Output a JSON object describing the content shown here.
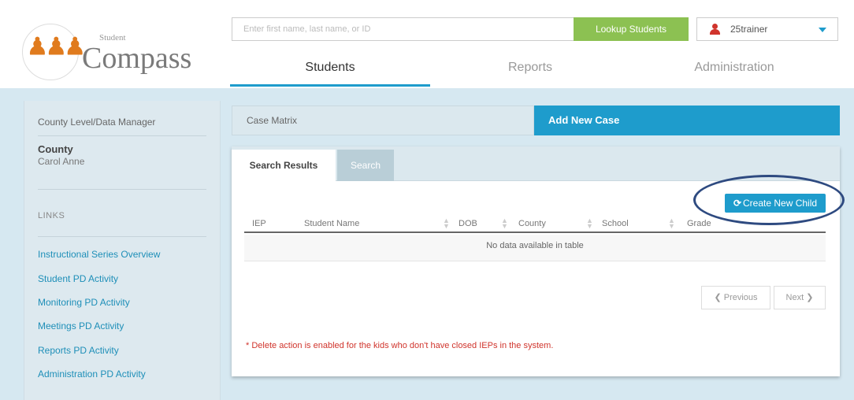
{
  "header": {
    "logo_sub": "Student",
    "logo_main": "Compass",
    "search_placeholder": "Enter first name, last name, or ID",
    "lookup_label": "Lookup Students",
    "username": "25trainer"
  },
  "nav": {
    "students": "Students",
    "reports": "Reports",
    "administration": "Administration"
  },
  "sidebar": {
    "role": "County Level/Data Manager",
    "county_label": "County",
    "user_name": "Carol Anne",
    "links_heading": "LINKS",
    "links": [
      "Instructional Series Overview",
      "Student PD Activity",
      "Monitoring PD Activity",
      "Meetings PD Activity",
      "Reports PD Activity",
      "Administration PD Activity"
    ]
  },
  "case": {
    "matrix_label": "Case Matrix",
    "add_label": "Add New Case"
  },
  "results": {
    "tab_results": "Search Results",
    "tab_search": "Search",
    "create_child": "Create New Child",
    "columns": [
      "IEP",
      "Student Name",
      "DOB",
      "County",
      "School",
      "Grade"
    ],
    "empty_message": "No data available in table",
    "prev_label": "Previous",
    "next_label": "Next",
    "note": "* Delete action is enabled for the kids who don't have closed IEPs in the system."
  },
  "colors": {
    "accent": "#1e9ccc",
    "lookup_green": "#8cc152",
    "note_red": "#d0342c",
    "annotation_ellipse": "#2e4a80"
  }
}
